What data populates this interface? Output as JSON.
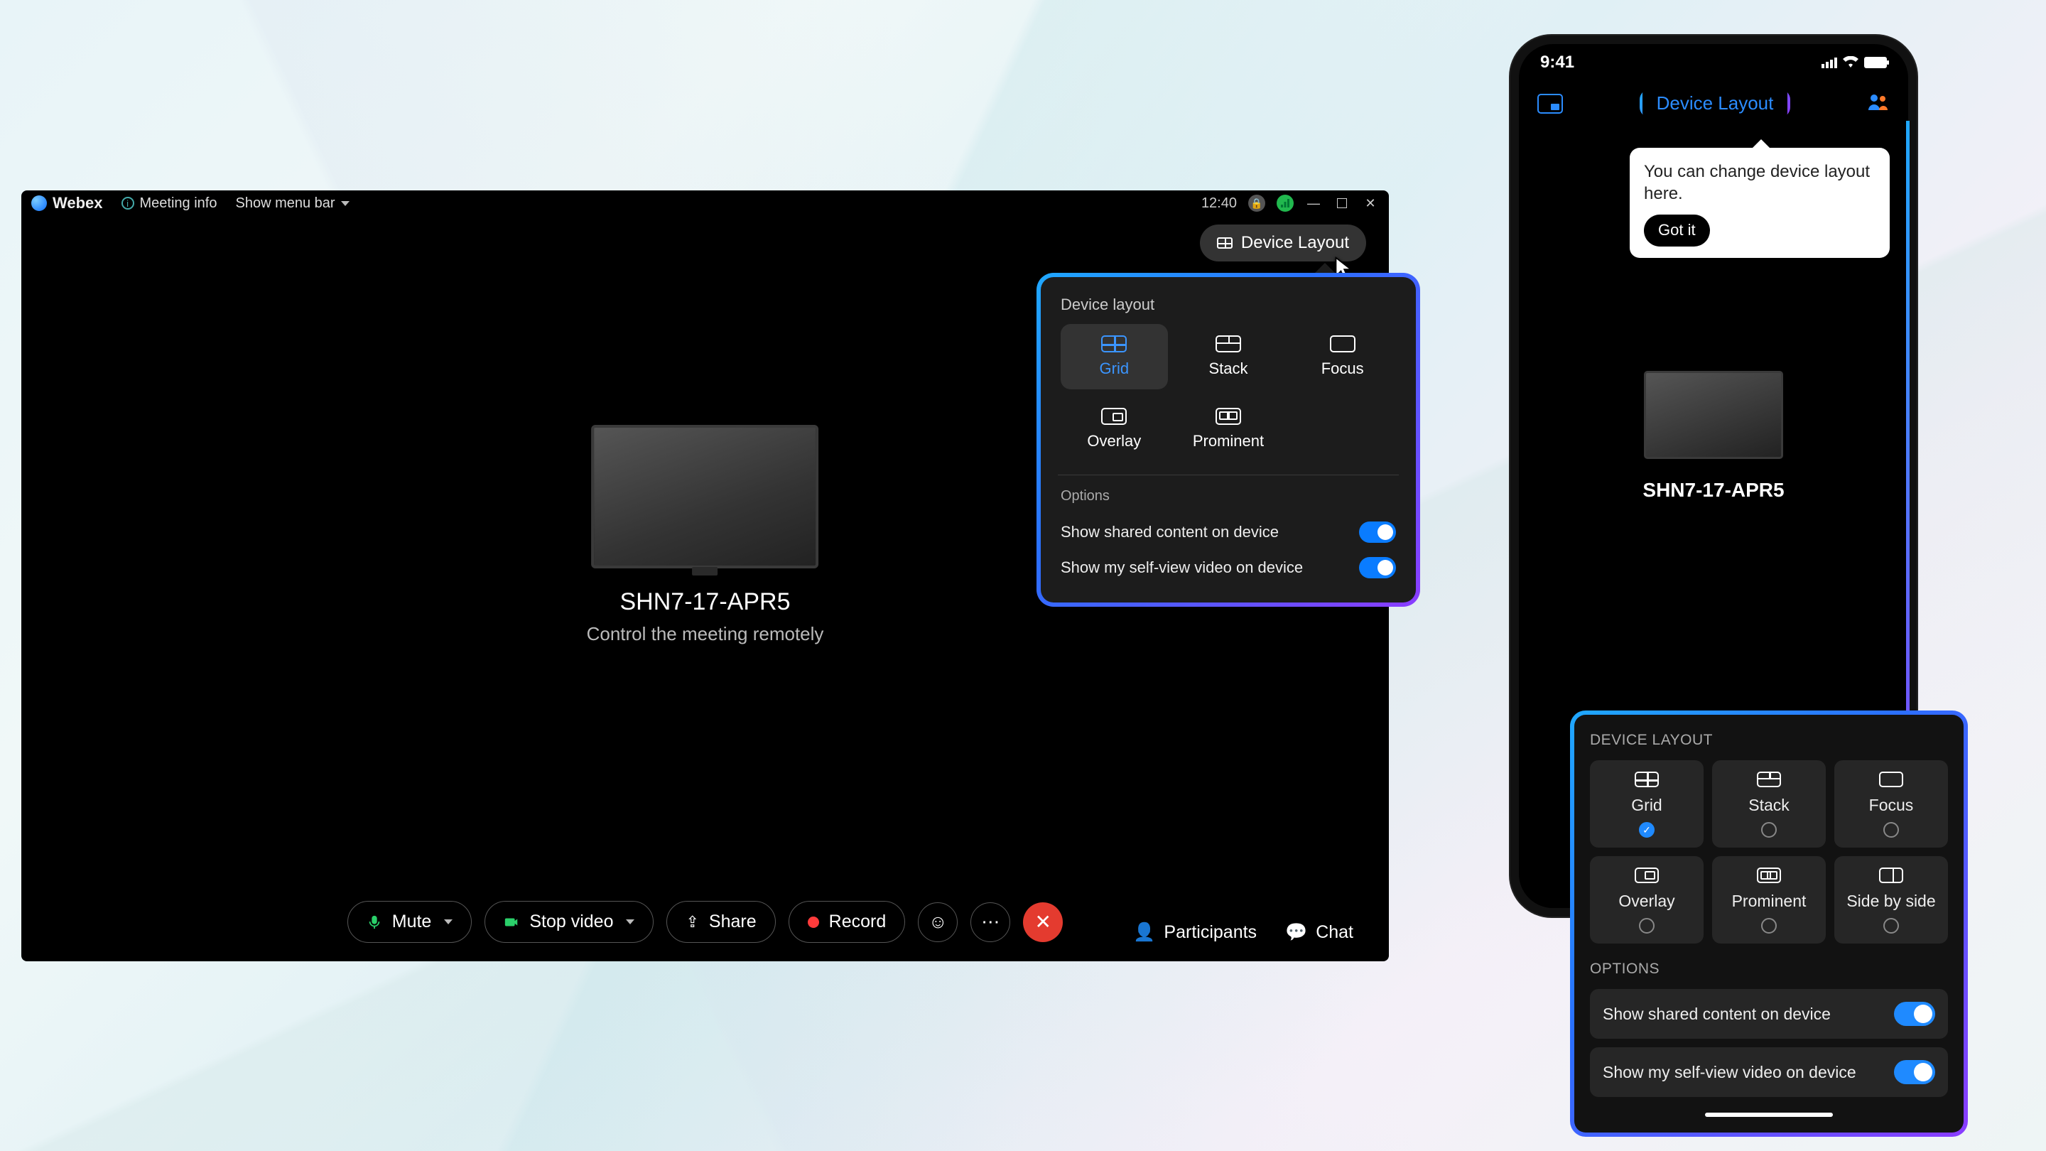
{
  "desktop": {
    "titlebar": {
      "app": "Webex",
      "meeting_info": "Meeting info",
      "show_menu": "Show menu bar",
      "clock": "12:40"
    },
    "device_layout_button": "Device Layout",
    "center": {
      "device_name": "SHN7-17-APR5",
      "subtitle": "Control the meeting remotely"
    },
    "popover": {
      "heading": "Device layout",
      "options": {
        "grid": "Grid",
        "stack": "Stack",
        "focus": "Focus",
        "overlay": "Overlay",
        "prominent": "Prominent"
      },
      "options_heading": "Options",
      "toggle_shared": "Show shared content on device",
      "toggle_selfview": "Show my self-view video on device"
    },
    "toolbar": {
      "mute": "Mute",
      "stop_video": "Stop video",
      "share": "Share",
      "record": "Record",
      "participants": "Participants",
      "chat": "Chat"
    }
  },
  "phone": {
    "status_time": "9:41",
    "device_layout_pill": "Device Layout",
    "tip_text": "You can change device layout here.",
    "tip_button": "Got it",
    "device_name": "SHN7-17-APR5"
  },
  "mpanel": {
    "heading": "DEVICE LAYOUT",
    "options": {
      "grid": "Grid",
      "stack": "Stack",
      "focus": "Focus",
      "overlay": "Overlay",
      "prominent": "Prominent",
      "sidebyside": "Side by side"
    },
    "options_heading": "OPTIONS",
    "toggle_shared": "Show shared content on device",
    "toggle_selfview": "Show my self-view video on device"
  }
}
